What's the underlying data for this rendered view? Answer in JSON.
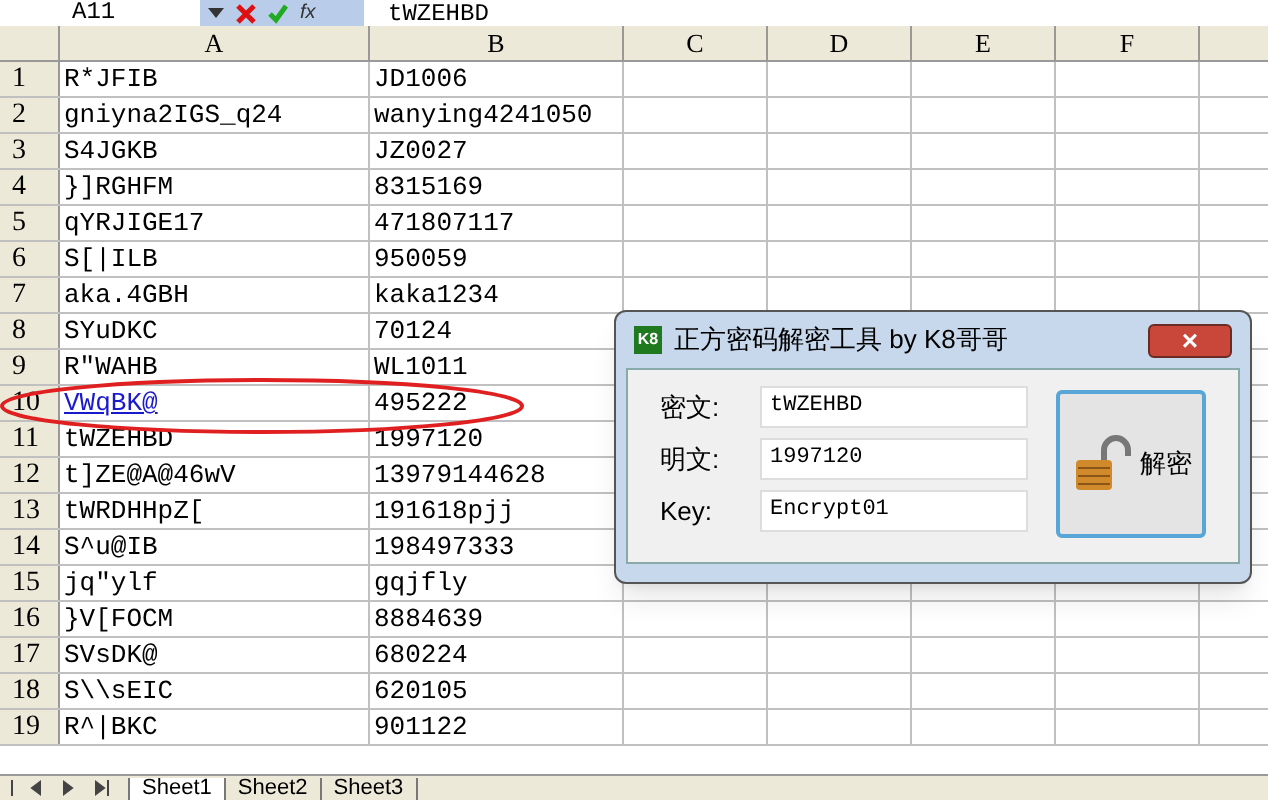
{
  "formula_bar": {
    "name_box": "A11",
    "formula": "tWZEHBD",
    "function_label": "fx"
  },
  "columns": [
    "A",
    "B",
    "C",
    "D",
    "E",
    "F"
  ],
  "rows": [
    {
      "number": "1",
      "cells": [
        {
          "text": "R*JFIB",
          "kind": "text"
        },
        {
          "text": "JD1006",
          "kind": "text"
        }
      ]
    },
    {
      "number": "2",
      "cells": [
        {
          "text": "gniyna2IGS_q24",
          "kind": "text"
        },
        {
          "text": "wanying4241050",
          "kind": "text"
        }
      ]
    },
    {
      "number": "3",
      "cells": [
        {
          "text": "S4JGKB",
          "kind": "text"
        },
        {
          "text": "JZ0027",
          "kind": "text"
        }
      ]
    },
    {
      "number": "4",
      "cells": [
        {
          "text": "}]RGHFM",
          "kind": "text"
        },
        {
          "text": "8315169",
          "kind": "text"
        }
      ]
    },
    {
      "number": "5",
      "cells": [
        {
          "text": "qYRJIGE17",
          "kind": "text"
        },
        {
          "text": "471807117",
          "kind": "text"
        }
      ]
    },
    {
      "number": "6",
      "cells": [
        {
          "text": "S[|ILB",
          "kind": "text"
        },
        {
          "text": "950059",
          "kind": "text"
        }
      ]
    },
    {
      "number": "7",
      "cells": [
        {
          "text": "aka.4GBH",
          "kind": "text"
        },
        {
          "text": "kaka1234",
          "kind": "text"
        }
      ]
    },
    {
      "number": "8",
      "cells": [
        {
          "text": "SYuDKC",
          "kind": "text"
        },
        {
          "text": "70124",
          "kind": "text"
        }
      ]
    },
    {
      "number": "9",
      "cells": [
        {
          "text": "R\"WAHB",
          "kind": "text"
        },
        {
          "text": "WL1011",
          "kind": "text"
        }
      ]
    },
    {
      "number": "10",
      "cells": [
        {
          "text": "VWqBK@",
          "kind": "link"
        },
        {
          "text": "495222",
          "kind": "text"
        }
      ]
    },
    {
      "number": "11",
      "cells": [
        {
          "text": "tWZEHBD",
          "kind": "text"
        },
        {
          "text": "1997120",
          "kind": "text"
        }
      ]
    },
    {
      "number": "12",
      "cells": [
        {
          "text": "t]ZE@A@46wV",
          "kind": "text"
        },
        {
          "text": "13979144628",
          "kind": "text"
        }
      ]
    },
    {
      "number": "13",
      "cells": [
        {
          "text": "tWRDHHpZ[",
          "kind": "text"
        },
        {
          "text": "191618pjj",
          "kind": "text"
        }
      ]
    },
    {
      "number": "14",
      "cells": [
        {
          "text": "S^u@IB",
          "kind": "text"
        },
        {
          "text": "198497333",
          "kind": "text"
        }
      ]
    },
    {
      "number": "15",
      "cells": [
        {
          "text": "jq\"ylf",
          "kind": "text"
        },
        {
          "text": "gqjfly",
          "kind": "text"
        }
      ]
    },
    {
      "number": "16",
      "cells": [
        {
          "text": "}V[FOCM",
          "kind": "text"
        },
        {
          "text": "8884639",
          "kind": "text"
        }
      ]
    },
    {
      "number": "17",
      "cells": [
        {
          "text": "SVsDK@",
          "kind": "text"
        },
        {
          "text": "680224",
          "kind": "text"
        }
      ]
    },
    {
      "number": "18",
      "cells": [
        {
          "text": "S\\\\sEIC",
          "kind": "text"
        },
        {
          "text": "620105",
          "kind": "text"
        }
      ]
    },
    {
      "number": "19",
      "cells": [
        {
          "text": "R^|BKC",
          "kind": "text"
        },
        {
          "text": "901122",
          "kind": "text"
        }
      ]
    }
  ],
  "sheet_tabs": [
    {
      "label": "Sheet1",
      "selected": true
    },
    {
      "label": "Sheet2",
      "selected": false
    },
    {
      "label": "Sheet3",
      "selected": false
    }
  ],
  "dialog": {
    "title": "正方密码解密工具 by K8哥哥",
    "app_icon_text": "K8",
    "close": "×",
    "fields": [
      {
        "label": "密文:",
        "value": "tWZEHBD"
      },
      {
        "label": "明文:",
        "value": "1997120"
      },
      {
        "label": "Key:",
        "value": "Encrypt01"
      }
    ],
    "button": "解密"
  }
}
